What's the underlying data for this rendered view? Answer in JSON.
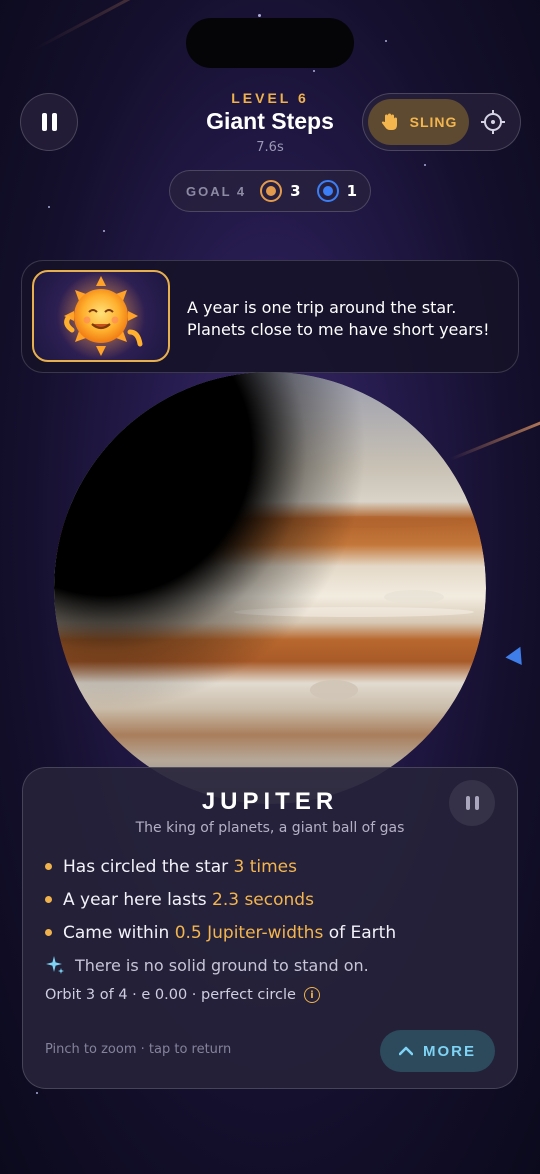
{
  "header": {
    "level_label": "LEVEL 6",
    "title": "Giant Steps",
    "timer": "7.6s"
  },
  "mode_toggle": {
    "sling_label": "SLING",
    "sling_icon": "hand-tap-icon",
    "target_icon": "crosshair-icon"
  },
  "goal": {
    "label": "GOAL 4",
    "orange_count": "3",
    "blue_count": "1"
  },
  "tip": {
    "line1": "A year is one trip around the star.",
    "line2": "Planets close to me have short years!"
  },
  "planet_card": {
    "name": "JUPITER",
    "subtitle": "The king of planets, a giant ball of gas",
    "facts": [
      {
        "text": "Has circled the star ",
        "highlight": "3 times",
        "suffix": ""
      },
      {
        "text": "A year here lasts ",
        "highlight": "2.3 seconds",
        "suffix": ""
      },
      {
        "text": "Came within ",
        "highlight": "0.5 Jupiter-widths",
        "suffix": " of Earth"
      }
    ],
    "note": "There is no solid ground to stand on.",
    "orbit_info": "Orbit 3 of 4 · e 0.00 · perfect circle",
    "hint": "Pinch to zoom · tap to return",
    "more_label": "MORE"
  },
  "colors": {
    "accent_gold": "#f0b24c",
    "accent_blue": "#3b7ef5",
    "more_text": "#7fd3f4"
  }
}
